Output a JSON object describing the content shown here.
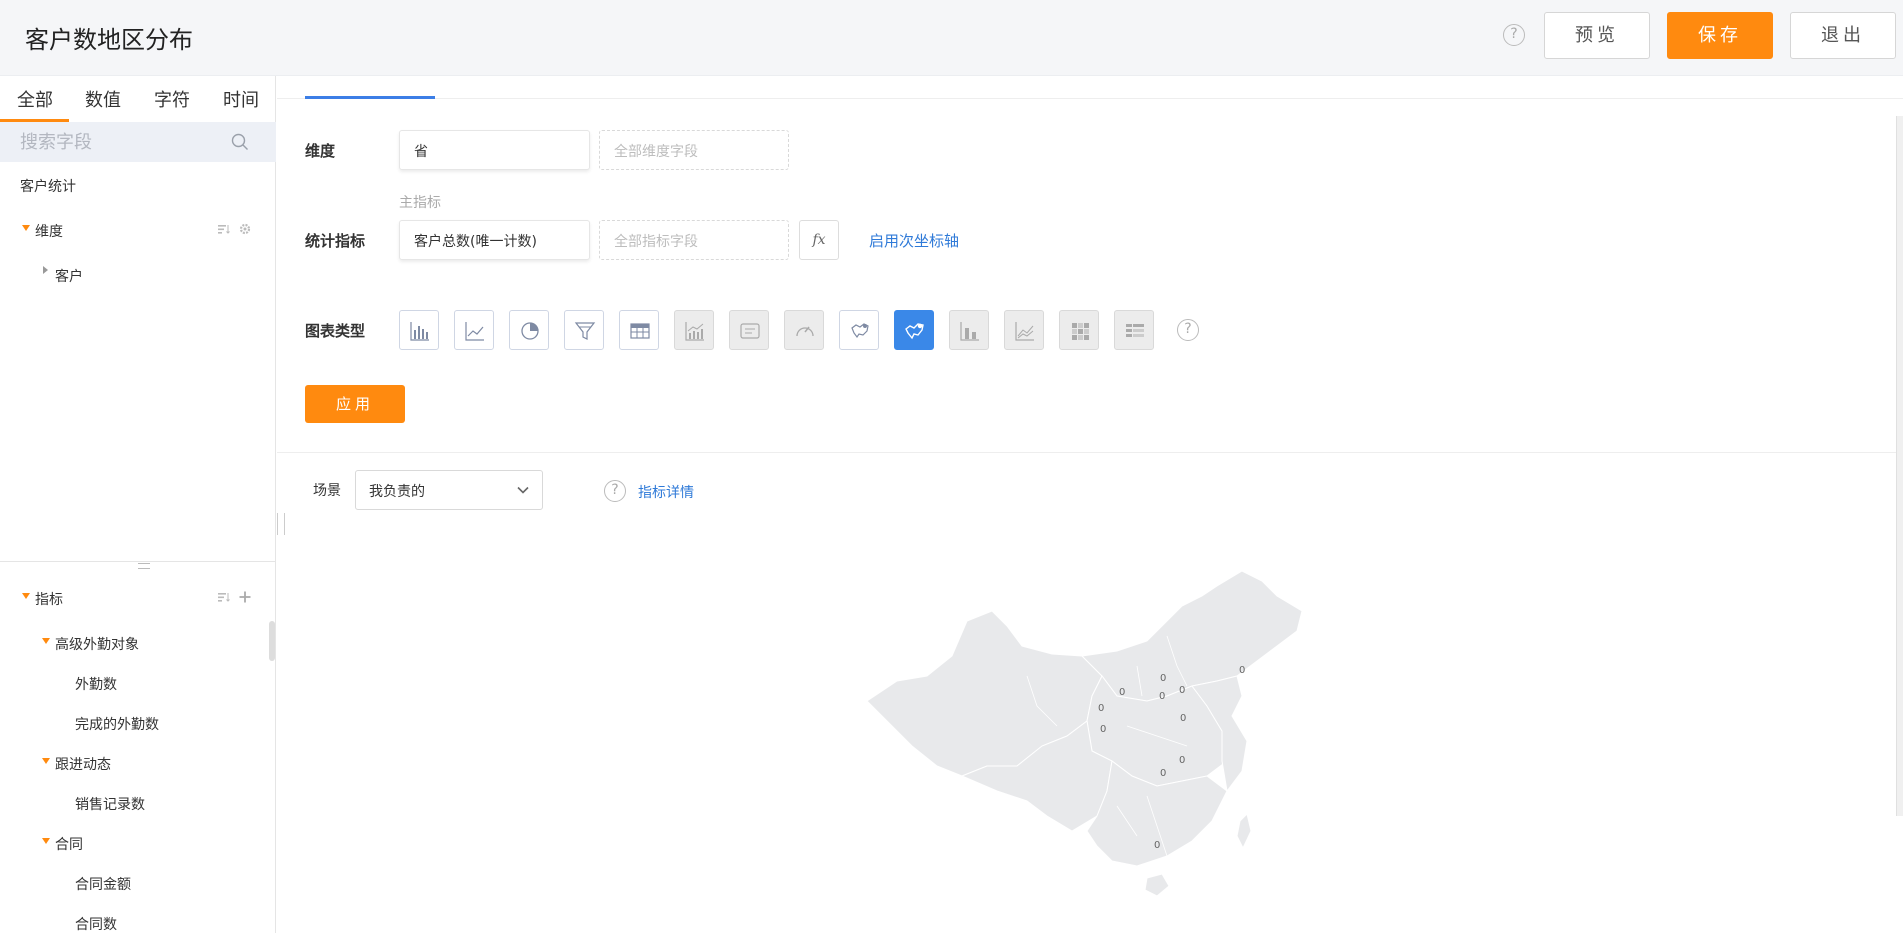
{
  "header": {
    "title": "客户数地区分布",
    "help": "?",
    "preview_label": "预览",
    "save_label": "保存",
    "exit_label": "退出"
  },
  "field_panel": {
    "type_tabs": [
      "全部",
      "数值",
      "字符",
      "时间"
    ],
    "active_tab": "全部",
    "search_placeholder": "搜索字段",
    "root_label": "客户统计",
    "dimension_group": {
      "label": "维度",
      "children": [
        "客户"
      ]
    },
    "metric_group": {
      "label": "指标",
      "groups": [
        {
          "label": "高级外勤对象",
          "items": [
            "外勤数",
            "完成的外勤数"
          ]
        },
        {
          "label": "跟进动态",
          "items": [
            "销售记录数"
          ]
        },
        {
          "label": "合同",
          "items": [
            "合同金额",
            "合同数"
          ]
        }
      ]
    }
  },
  "config": {
    "dimension_label": "维度",
    "dimension_value": "省",
    "dimension_placeholder": "全部维度字段",
    "main_metric_label": "主指标",
    "metric_label": "统计指标",
    "metric_value": "客户总数(唯一计数)",
    "metric_placeholder": "全部指标字段",
    "fx_label": "fx",
    "secondary_axis_link": "启用次坐标轴",
    "chart_type_label": "图表类型",
    "chart_types": [
      {
        "icon": "bar-chart-icon",
        "state": "enabled"
      },
      {
        "icon": "line-chart-icon",
        "state": "enabled"
      },
      {
        "icon": "pie-chart-icon",
        "state": "enabled"
      },
      {
        "icon": "funnel-chart-icon",
        "state": "enabled"
      },
      {
        "icon": "table-chart-icon",
        "state": "enabled"
      },
      {
        "icon": "combo-chart-icon",
        "state": "disabled"
      },
      {
        "icon": "text-card-icon",
        "state": "disabled"
      },
      {
        "icon": "gauge-chart-icon",
        "state": "disabled"
      },
      {
        "icon": "world-map-icon",
        "state": "enabled"
      },
      {
        "icon": "china-map-icon",
        "state": "active"
      },
      {
        "icon": "stacked-bar-icon",
        "state": "disabled"
      },
      {
        "icon": "area-chart-icon",
        "state": "disabled"
      },
      {
        "icon": "heatmap-icon",
        "state": "disabled"
      },
      {
        "icon": "pivot-table-icon",
        "state": "disabled"
      }
    ],
    "chart_help": "?",
    "apply_label": "应用"
  },
  "preview": {
    "scene_label": "场景",
    "scene_value": "我负责的",
    "metric_detail_help": "?",
    "metric_detail_link": "指标详情",
    "map_labels": [
      "0",
      "0",
      "0",
      "0",
      "0",
      "0",
      "0",
      "0",
      "0",
      "0",
      "0"
    ],
    "map_fill": "#e8e9eb",
    "map_border": "#ffffff"
  },
  "colors": {
    "accent": "#ff8a0f",
    "link": "#2f7ad8",
    "active_chart": "#3a88e8"
  }
}
